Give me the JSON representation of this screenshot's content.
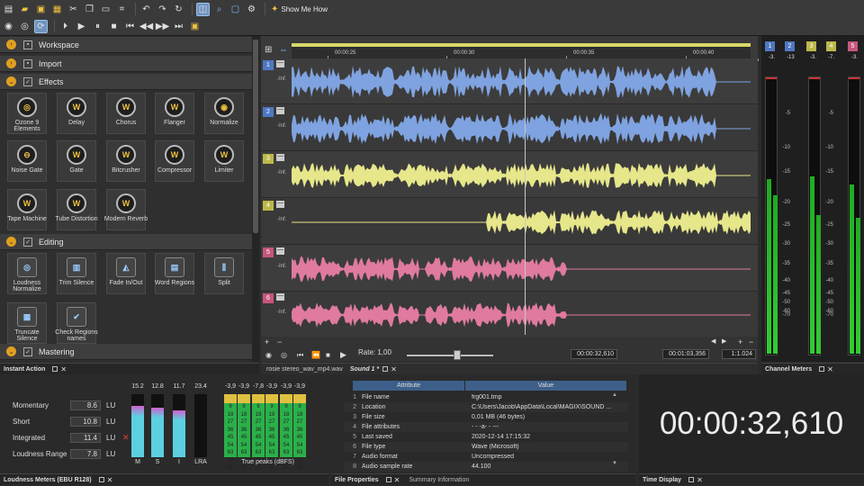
{
  "toolbar": {
    "show_me_how": "Show Me How",
    "row1_icons": [
      "new-file-icon",
      "open-folder-icon",
      "save-icon",
      "save-all-icon",
      "cut-icon",
      "copy-icon",
      "paste-icon",
      "crop-icon",
      "undo-icon",
      "redo-icon",
      "refresh-icon",
      "mode-toggle-icon",
      "zoom-icon",
      "screen-icon",
      "settings-icon",
      "info-icon"
    ],
    "row2_icons": [
      "record-icon",
      "loop-icon",
      "sync-icon",
      "play-from-start-icon",
      "play-icon",
      "pause-icon",
      "stop-icon",
      "prev-marker-icon",
      "rewind-icon",
      "fast-forward-icon",
      "next-marker-icon",
      "scrub-icon"
    ]
  },
  "left_panel": {
    "sections": {
      "workspace": "Workspace",
      "import": "Import",
      "effects": "Effects",
      "editing": "Editing",
      "mastering": "Mastering"
    },
    "effects": [
      {
        "label": "Ozone 9 Elements",
        "icon": "ozone-icon"
      },
      {
        "label": "Delay",
        "icon": "delay-icon"
      },
      {
        "label": "Chorus",
        "icon": "chorus-icon"
      },
      {
        "label": "Flanger",
        "icon": "flanger-icon"
      },
      {
        "label": "Normalize",
        "icon": "normalize-icon"
      },
      {
        "label": "Noise Gate",
        "icon": "noise-gate-icon"
      },
      {
        "label": "Gate",
        "icon": "gate-icon"
      },
      {
        "label": "Bitcrusher",
        "icon": "bitcrusher-icon"
      },
      {
        "label": "Compressor",
        "icon": "compressor-icon"
      },
      {
        "label": "Limiter",
        "icon": "limiter-icon"
      },
      {
        "label": "Tape Machine",
        "icon": "tape-machine-icon"
      },
      {
        "label": "Tube Distortion",
        "icon": "tube-distortion-icon"
      },
      {
        "label": "Modern Reverb",
        "icon": "modern-reverb-icon"
      }
    ],
    "editing": [
      {
        "label": "Loudness Normalize",
        "icon": "loudness-normalize-icon"
      },
      {
        "label": "Trim Silence",
        "icon": "trim-silence-icon"
      },
      {
        "label": "Fade In/Out",
        "icon": "fade-icon"
      },
      {
        "label": "Word Regions",
        "icon": "word-regions-icon"
      },
      {
        "label": "Split",
        "icon": "split-icon"
      },
      {
        "label": "Truncate Silence",
        "icon": "truncate-silence-icon"
      },
      {
        "label": "Check Regions names",
        "icon": "check-regions-icon"
      }
    ]
  },
  "ruler": {
    "ticks": [
      "00:00:25",
      "00:00:30",
      "00:00:35",
      "00:00:40"
    ]
  },
  "tracks": [
    {
      "num": "1",
      "inf": "-Inf.",
      "color": "#7fa3e0"
    },
    {
      "num": "2",
      "inf": "-Inf.",
      "color": "#7fa3e0"
    },
    {
      "num": "3",
      "inf": "-Inf.",
      "color": "#e6e68a"
    },
    {
      "num": "4",
      "inf": "-Inf.",
      "color": "#e6e68a"
    },
    {
      "num": "5",
      "inf": "-Inf.",
      "color": "#e07aa0"
    },
    {
      "num": "6",
      "inf": "-Inf.",
      "color": "#e07aa0"
    }
  ],
  "transport": {
    "rate_label": "Rate: 1,00",
    "position": "00:00:32,610",
    "length": "00:01:03,356",
    "zoom": "1:1.024"
  },
  "tabs": {
    "file_tab": "rosie stereo_wav_mp4.wav",
    "sound_tab": "Sound 1 *"
  },
  "channel_meters": {
    "title": "Channel Meters",
    "buttons": [
      "1",
      "2",
      "3",
      "4",
      "5"
    ],
    "peaks": [
      "-3.",
      "-13",
      "-3.",
      "-7.",
      "-3."
    ],
    "scale": [
      "-5",
      "-10",
      "-15",
      "-20",
      "-25",
      "-30",
      "-35",
      "-40",
      "-45",
      "-50",
      "-60",
      "-70"
    ]
  },
  "loudness": {
    "panel_title": "Instant Action",
    "title": "Loudness Meters (EBU R128)",
    "rows": [
      {
        "label": "Momentary",
        "value": "8.6",
        "unit": "LU"
      },
      {
        "label": "Short",
        "value": "10.8",
        "unit": "LU"
      },
      {
        "label": "Integrated",
        "value": "11.4",
        "unit": "LU"
      },
      {
        "label": "Loudness Range",
        "value": "7.8",
        "unit": "LU"
      }
    ],
    "bars": [
      {
        "name": "M",
        "value": "15.2",
        "level": 0.82
      },
      {
        "name": "S",
        "value": "12.8",
        "level": 0.78
      },
      {
        "name": "I",
        "value": "11.7",
        "level": 0.74
      },
      {
        "name": "LRA",
        "value": "23.4",
        "level": 0.0
      }
    ],
    "true_peaks_label": "True peaks (dBFS)",
    "true_peak_values": [
      "-3,9",
      "-3,9",
      "-7,8",
      "-3,9",
      "-3,9",
      "-3,9"
    ],
    "true_peak_scale": [
      "9",
      "18",
      "27",
      "36",
      "45",
      "54",
      "63",
      "72",
      "81"
    ]
  },
  "file_properties": {
    "title": "File Properties",
    "summary_tab": "Summary Information",
    "col_attribute": "Attribute",
    "col_value": "Value",
    "rows": [
      {
        "n": "1",
        "attr": "File name",
        "val": "frg001.tmp"
      },
      {
        "n": "2",
        "attr": "Location",
        "val": "C:\\Users\\Jacob\\AppData\\Local\\MAGIX\\SOUND ..."
      },
      {
        "n": "3",
        "attr": "File size",
        "val": "0,01 MB (46 bytes)"
      },
      {
        "n": "4",
        "attr": "File attributes",
        "val": "- - -a- - ---"
      },
      {
        "n": "5",
        "attr": "Last saved",
        "val": "2020-12-14  17:15:32"
      },
      {
        "n": "6",
        "attr": "File type",
        "val": "Wave (Microsoft)"
      },
      {
        "n": "7",
        "attr": "Audio format",
        "val": "Uncompressed"
      },
      {
        "n": "8",
        "attr": "Audio sample rate",
        "val": "44.100"
      }
    ]
  },
  "time_display": {
    "title": "Time Display",
    "value": "00:00:32,610"
  }
}
